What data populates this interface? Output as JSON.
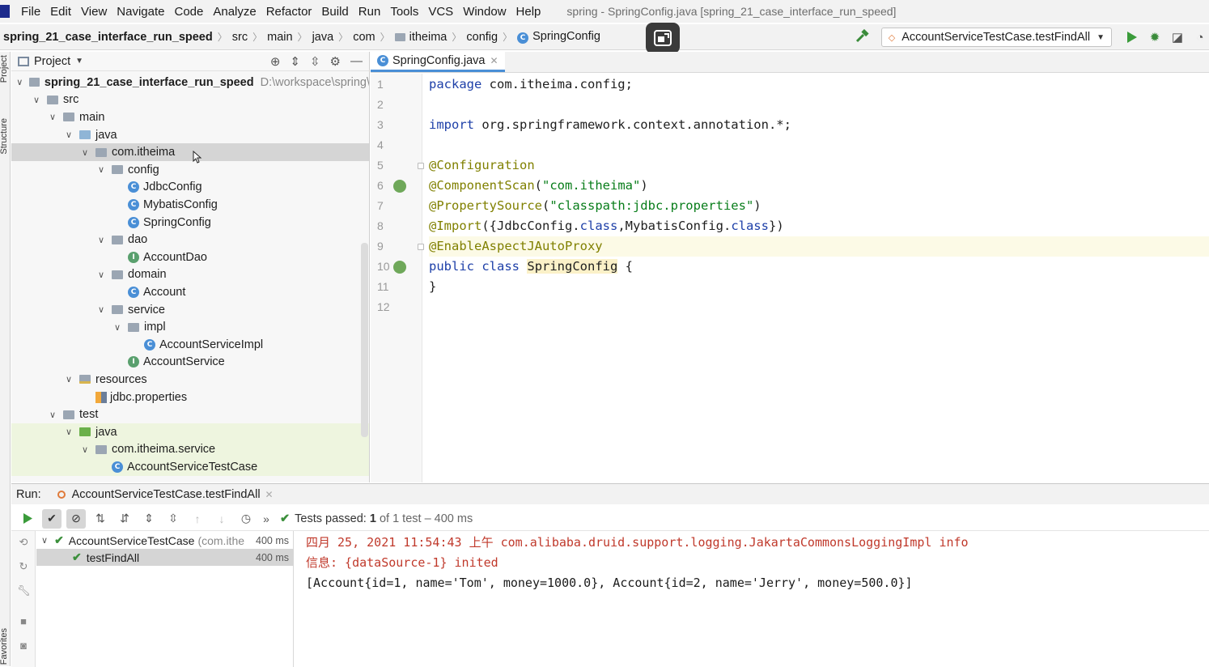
{
  "menubar": {
    "items": [
      "File",
      "Edit",
      "View",
      "Navigate",
      "Code",
      "Analyze",
      "Refactor",
      "Build",
      "Run",
      "Tools",
      "VCS",
      "Window",
      "Help"
    ],
    "window_title": "spring - SpringConfig.java [spring_21_case_interface_run_speed]"
  },
  "breadcrumb": [
    "spring_21_case_interface_run_speed",
    "src",
    "main",
    "java",
    "com",
    "itheima",
    "config",
    "SpringConfig"
  ],
  "run_config": {
    "label": "AccountServiceTestCase.testFindAll"
  },
  "project": {
    "header": "Project",
    "tree": [
      {
        "label": "spring_21_case_interface_run_speed",
        "extra": "D:\\workspace\\spring\\",
        "level": 0,
        "kind": "module",
        "open": true
      },
      {
        "label": "src",
        "level": 1,
        "kind": "folder",
        "open": true
      },
      {
        "label": "main",
        "level": 2,
        "kind": "folder",
        "open": true
      },
      {
        "label": "java",
        "level": 3,
        "kind": "src",
        "open": true
      },
      {
        "label": "com.itheima",
        "level": 4,
        "kind": "folder",
        "open": true,
        "selected": true
      },
      {
        "label": "config",
        "level": 5,
        "kind": "folder",
        "open": true
      },
      {
        "label": "JdbcConfig",
        "level": 6,
        "kind": "class"
      },
      {
        "label": "MybatisConfig",
        "level": 6,
        "kind": "class"
      },
      {
        "label": "SpringConfig",
        "level": 6,
        "kind": "class"
      },
      {
        "label": "dao",
        "level": 5,
        "kind": "folder",
        "open": true
      },
      {
        "label": "AccountDao",
        "level": 6,
        "kind": "interface"
      },
      {
        "label": "domain",
        "level": 5,
        "kind": "folder",
        "open": true
      },
      {
        "label": "Account",
        "level": 6,
        "kind": "class"
      },
      {
        "label": "service",
        "level": 5,
        "kind": "folder",
        "open": true
      },
      {
        "label": "impl",
        "level": 6,
        "kind": "folder",
        "open": true
      },
      {
        "label": "AccountServiceImpl",
        "level": 7,
        "kind": "class"
      },
      {
        "label": "AccountService",
        "level": 6,
        "kind": "interface"
      },
      {
        "label": "resources",
        "level": 3,
        "kind": "res",
        "open": true
      },
      {
        "label": "jdbc.properties",
        "level": 4,
        "kind": "props"
      },
      {
        "label": "test",
        "level": 2,
        "kind": "folder",
        "open": true
      },
      {
        "label": "java",
        "level": 3,
        "kind": "test",
        "open": true,
        "testbg": true
      },
      {
        "label": "com.itheima.service",
        "level": 4,
        "kind": "folder",
        "open": true,
        "testbg": true
      },
      {
        "label": "AccountServiceTestCase",
        "level": 5,
        "kind": "class",
        "testbg": true
      }
    ]
  },
  "editor": {
    "tab_label": "SpringConfig.java",
    "line_numbers": [
      "1",
      "2",
      "3",
      "4",
      "5",
      "6",
      "7",
      "8",
      "9",
      "10",
      "11",
      "12"
    ],
    "lines": [
      [
        {
          "t": "package",
          "c": "kw"
        },
        {
          "t": " com.itheima.config;",
          "c": ""
        }
      ],
      [],
      [
        {
          "t": "import",
          "c": "kw"
        },
        {
          "t": " org.springframework.context.annotation.*;",
          "c": ""
        }
      ],
      [],
      [
        {
          "t": "@Configuration",
          "c": "ann"
        }
      ],
      [
        {
          "t": "@ComponentScan",
          "c": "ann"
        },
        {
          "t": "(",
          "c": ""
        },
        {
          "t": "\"com.itheima\"",
          "c": "str"
        },
        {
          "t": ")",
          "c": ""
        }
      ],
      [
        {
          "t": "@PropertySource",
          "c": "ann"
        },
        {
          "t": "(",
          "c": ""
        },
        {
          "t": "\"classpath:jdbc.properties\"",
          "c": "str"
        },
        {
          "t": ")",
          "c": ""
        }
      ],
      [
        {
          "t": "@Import",
          "c": "ann"
        },
        {
          "t": "({JdbcConfig.",
          "c": ""
        },
        {
          "t": "class",
          "c": "kw"
        },
        {
          "t": ",MybatisConfig.",
          "c": ""
        },
        {
          "t": "class",
          "c": "kw"
        },
        {
          "t": "})",
          "c": ""
        }
      ],
      [
        {
          "t": "@EnableAspectJAutoProxy",
          "c": "ann"
        }
      ],
      [
        {
          "t": "public",
          "c": "kw"
        },
        {
          "t": " ",
          "c": ""
        },
        {
          "t": "class",
          "c": "kw"
        },
        {
          "t": " ",
          "c": ""
        },
        {
          "t": "SpringConfig",
          "c": "hl-class"
        },
        {
          "t": " {",
          "c": ""
        }
      ],
      [
        {
          "t": "}",
          "c": ""
        }
      ],
      []
    ]
  },
  "run": {
    "label": "Run:",
    "tab": "AccountServiceTestCase.testFindAll",
    "status_prefix": "Tests passed:",
    "status_count": "1",
    "status_suffix": "of 1 test – 400 ms",
    "tests": [
      {
        "name": "AccountServiceTestCase",
        "pkg": "(com.ithe",
        "dur": "400 ms"
      },
      {
        "name": "testFindAll",
        "dur": "400 ms"
      }
    ],
    "console": [
      {
        "text": "四月 25, 2021 11:54:43 上午 com.alibaba.druid.support.logging.JakartaCommonsLoggingImpl info",
        "kind": "err"
      },
      {
        "text": "信息: {dataSource-1} inited",
        "kind": "err"
      },
      {
        "text": "[Account{id=1, name='Tom', money=1000.0}, Account{id=2, name='Jerry', money=500.0}]",
        "kind": "out"
      }
    ]
  },
  "sidebar_labels": {
    "project": "Project",
    "structure": "Structure",
    "favorites": "Favorites"
  }
}
